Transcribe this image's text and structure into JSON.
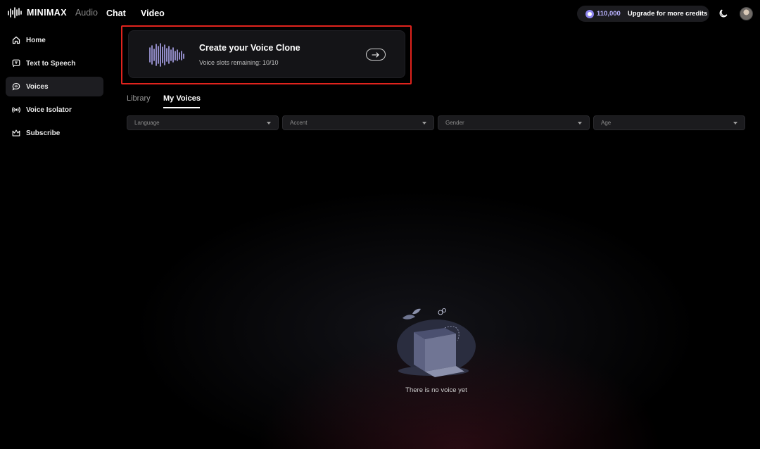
{
  "app": {
    "brand": "MINIMAX",
    "product": "Audio",
    "top_nav": [
      "Chat",
      "Video"
    ],
    "credits_amount": "110,000",
    "upgrade_label": "Upgrade for more credits"
  },
  "sidebar": {
    "items": [
      {
        "label": "Home",
        "icon": "home-icon"
      },
      {
        "label": "Text to Speech",
        "icon": "text-to-speech-icon"
      },
      {
        "label": "Voices",
        "icon": "voices-icon",
        "active": true
      },
      {
        "label": "Voice Isolator",
        "icon": "voice-isolator-icon"
      },
      {
        "label": "Subscribe",
        "icon": "crown-icon"
      }
    ]
  },
  "clone_card": {
    "title": "Create your Voice Clone",
    "subtitle": "Voice slots remaining: 10/10"
  },
  "tabs": [
    {
      "label": "Library",
      "active": false
    },
    {
      "label": "My Voices",
      "active": true
    }
  ],
  "filters": [
    {
      "placeholder": "Language"
    },
    {
      "placeholder": "Accent"
    },
    {
      "placeholder": "Gender"
    },
    {
      "placeholder": "Age"
    }
  ],
  "empty_state": {
    "message": "There is no voice yet"
  },
  "colors": {
    "background": "#000000",
    "card": "#141417",
    "highlight_border": "#e0231d",
    "accent": "#8e86f0"
  }
}
